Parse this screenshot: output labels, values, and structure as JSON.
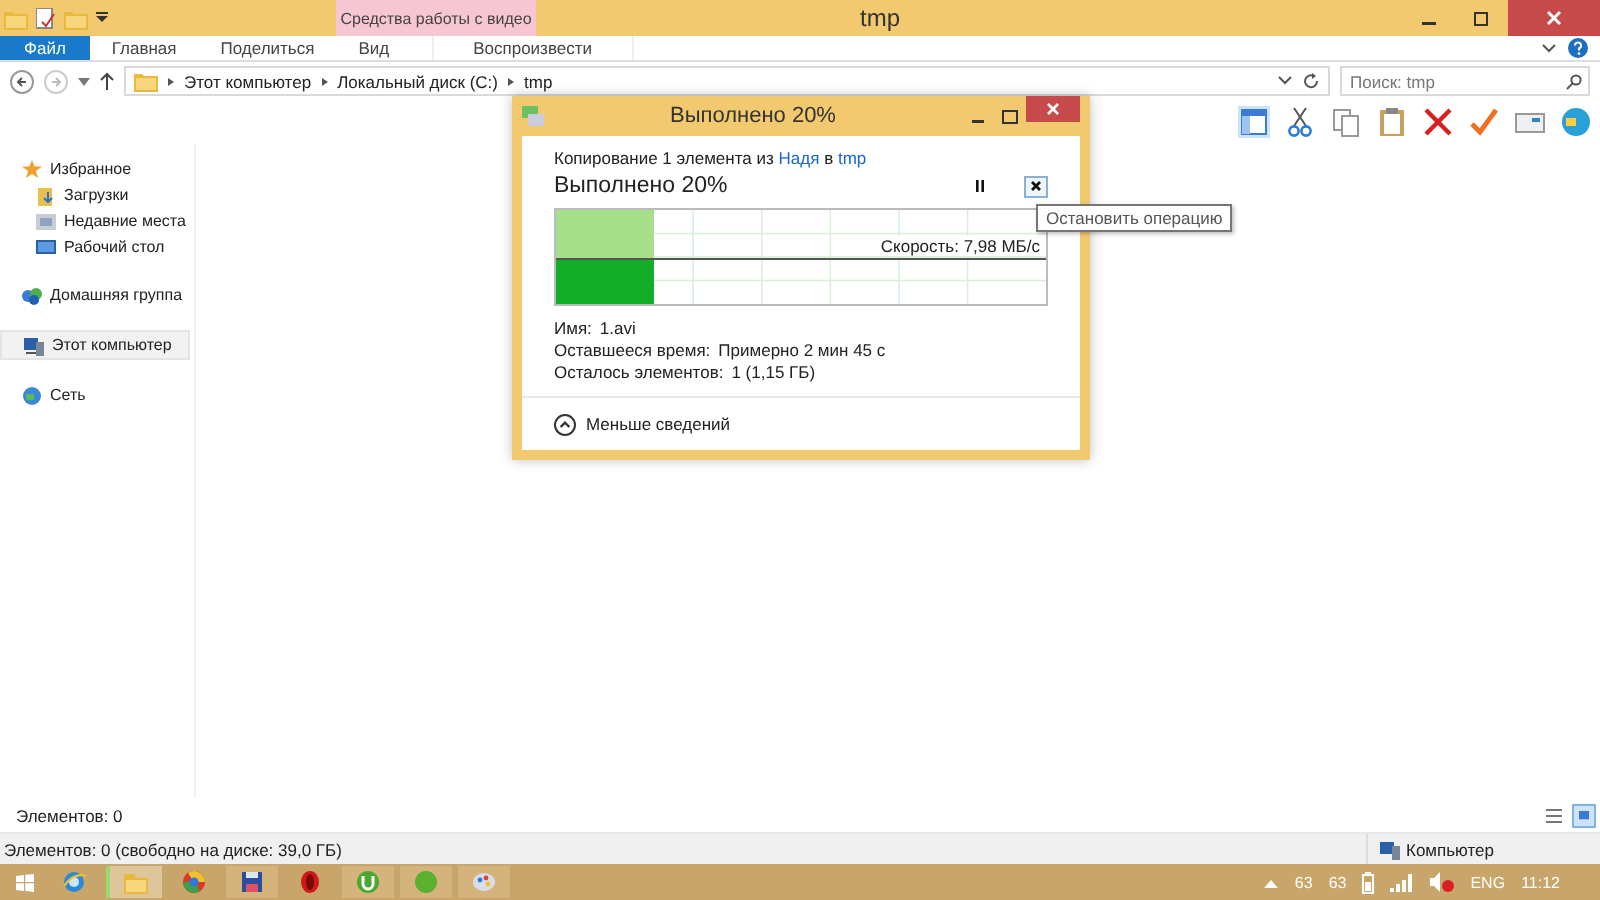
{
  "window": {
    "title": "tmp"
  },
  "contextual_group": {
    "label": "Средства работы с видео"
  },
  "ribbon_tabs": [
    {
      "label": "Файл",
      "kind": "file"
    },
    {
      "label": "Главная",
      "kind": "tab"
    },
    {
      "label": "Поделиться",
      "kind": "tab"
    },
    {
      "label": "Вид",
      "kind": "tab"
    },
    {
      "label": "Воспроизвести",
      "kind": "context"
    }
  ],
  "address_bar": {
    "path": [
      "Этот компьютер",
      "Локальный диск (C:)",
      "tmp"
    ]
  },
  "search": {
    "placeholder": "Поиск: tmp"
  },
  "nav_pane": {
    "groups": [
      {
        "label": "Избранное",
        "kind": "star",
        "selected": false,
        "children": [
          {
            "label": "Загрузки",
            "kind": "downloads",
            "selected": false
          },
          {
            "label": "Недавние места",
            "kind": "recent",
            "selected": false
          },
          {
            "label": "Рабочий стол",
            "kind": "desktop",
            "selected": false
          }
        ]
      },
      {
        "label": "Домашняя группа",
        "kind": "homegroup",
        "selected": false
      },
      {
        "label": "Этот компьютер",
        "kind": "computer",
        "selected": true
      },
      {
        "label": "Сеть",
        "kind": "network",
        "selected": false
      }
    ]
  },
  "copy_dialog": {
    "title": "Выполнено 20%",
    "source": {
      "prefix": "Копирование 1 элемента из",
      "from": "Надя",
      "middle": "в",
      "to": "tmp"
    },
    "heading": "Выполнено 20%",
    "progress": {
      "level": 0.2,
      "speed": "Скорость: 7,98 МБ/с"
    },
    "details": [
      {
        "label": "Имя:",
        "value": "1.avi"
      },
      {
        "label": "Оставшееся время:",
        "value": "Примерно 2 мин 45 с"
      },
      {
        "label": "Осталось элементов:",
        "value": "1 (1,15 ГБ)"
      }
    ],
    "toggle": "Меньше сведений",
    "tooltip": "Остановить операцию"
  },
  "status_bar": {
    "text": "Элементов: 0"
  },
  "details_bar": {
    "text": "Элементов: 0 (свободно на диске: 39,0 ГБ)",
    "location": "Компьютер"
  },
  "taskbar": {
    "apps": [
      {
        "kind": "e-logo",
        "selected": false
      },
      {
        "kind": "folder",
        "selected": true
      },
      {
        "kind": "wheel",
        "selected": false
      },
      {
        "kind": "floppy",
        "selected": false
      },
      {
        "kind": "ring",
        "selected": false
      },
      {
        "kind": "u-logo",
        "selected": false
      },
      {
        "kind": "green-dot",
        "selected": false
      },
      {
        "kind": "palette",
        "selected": false
      }
    ],
    "tray": [
      "63",
      "63"
    ],
    "language": "ENG",
    "time": "11:12"
  }
}
